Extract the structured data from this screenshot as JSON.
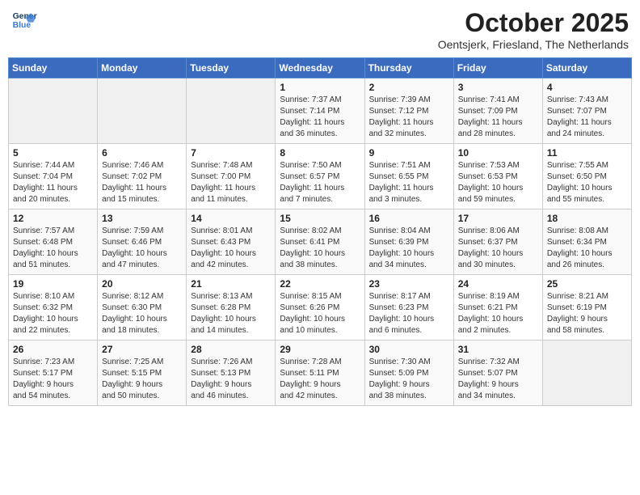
{
  "header": {
    "logo_line1": "General",
    "logo_line2": "Blue",
    "month": "October 2025",
    "location": "Oentsjerk, Friesland, The Netherlands"
  },
  "days_of_week": [
    "Sunday",
    "Monday",
    "Tuesday",
    "Wednesday",
    "Thursday",
    "Friday",
    "Saturday"
  ],
  "weeks": [
    [
      {
        "day": "",
        "info": ""
      },
      {
        "day": "",
        "info": ""
      },
      {
        "day": "",
        "info": ""
      },
      {
        "day": "1",
        "info": "Sunrise: 7:37 AM\nSunset: 7:14 PM\nDaylight: 11 hours\nand 36 minutes."
      },
      {
        "day": "2",
        "info": "Sunrise: 7:39 AM\nSunset: 7:12 PM\nDaylight: 11 hours\nand 32 minutes."
      },
      {
        "day": "3",
        "info": "Sunrise: 7:41 AM\nSunset: 7:09 PM\nDaylight: 11 hours\nand 28 minutes."
      },
      {
        "day": "4",
        "info": "Sunrise: 7:43 AM\nSunset: 7:07 PM\nDaylight: 11 hours\nand 24 minutes."
      }
    ],
    [
      {
        "day": "5",
        "info": "Sunrise: 7:44 AM\nSunset: 7:04 PM\nDaylight: 11 hours\nand 20 minutes."
      },
      {
        "day": "6",
        "info": "Sunrise: 7:46 AM\nSunset: 7:02 PM\nDaylight: 11 hours\nand 15 minutes."
      },
      {
        "day": "7",
        "info": "Sunrise: 7:48 AM\nSunset: 7:00 PM\nDaylight: 11 hours\nand 11 minutes."
      },
      {
        "day": "8",
        "info": "Sunrise: 7:50 AM\nSunset: 6:57 PM\nDaylight: 11 hours\nand 7 minutes."
      },
      {
        "day": "9",
        "info": "Sunrise: 7:51 AM\nSunset: 6:55 PM\nDaylight: 11 hours\nand 3 minutes."
      },
      {
        "day": "10",
        "info": "Sunrise: 7:53 AM\nSunset: 6:53 PM\nDaylight: 10 hours\nand 59 minutes."
      },
      {
        "day": "11",
        "info": "Sunrise: 7:55 AM\nSunset: 6:50 PM\nDaylight: 10 hours\nand 55 minutes."
      }
    ],
    [
      {
        "day": "12",
        "info": "Sunrise: 7:57 AM\nSunset: 6:48 PM\nDaylight: 10 hours\nand 51 minutes."
      },
      {
        "day": "13",
        "info": "Sunrise: 7:59 AM\nSunset: 6:46 PM\nDaylight: 10 hours\nand 47 minutes."
      },
      {
        "day": "14",
        "info": "Sunrise: 8:01 AM\nSunset: 6:43 PM\nDaylight: 10 hours\nand 42 minutes."
      },
      {
        "day": "15",
        "info": "Sunrise: 8:02 AM\nSunset: 6:41 PM\nDaylight: 10 hours\nand 38 minutes."
      },
      {
        "day": "16",
        "info": "Sunrise: 8:04 AM\nSunset: 6:39 PM\nDaylight: 10 hours\nand 34 minutes."
      },
      {
        "day": "17",
        "info": "Sunrise: 8:06 AM\nSunset: 6:37 PM\nDaylight: 10 hours\nand 30 minutes."
      },
      {
        "day": "18",
        "info": "Sunrise: 8:08 AM\nSunset: 6:34 PM\nDaylight: 10 hours\nand 26 minutes."
      }
    ],
    [
      {
        "day": "19",
        "info": "Sunrise: 8:10 AM\nSunset: 6:32 PM\nDaylight: 10 hours\nand 22 minutes."
      },
      {
        "day": "20",
        "info": "Sunrise: 8:12 AM\nSunset: 6:30 PM\nDaylight: 10 hours\nand 18 minutes."
      },
      {
        "day": "21",
        "info": "Sunrise: 8:13 AM\nSunset: 6:28 PM\nDaylight: 10 hours\nand 14 minutes."
      },
      {
        "day": "22",
        "info": "Sunrise: 8:15 AM\nSunset: 6:26 PM\nDaylight: 10 hours\nand 10 minutes."
      },
      {
        "day": "23",
        "info": "Sunrise: 8:17 AM\nSunset: 6:23 PM\nDaylight: 10 hours\nand 6 minutes."
      },
      {
        "day": "24",
        "info": "Sunrise: 8:19 AM\nSunset: 6:21 PM\nDaylight: 10 hours\nand 2 minutes."
      },
      {
        "day": "25",
        "info": "Sunrise: 8:21 AM\nSunset: 6:19 PM\nDaylight: 9 hours\nand 58 minutes."
      }
    ],
    [
      {
        "day": "26",
        "info": "Sunrise: 7:23 AM\nSunset: 5:17 PM\nDaylight: 9 hours\nand 54 minutes."
      },
      {
        "day": "27",
        "info": "Sunrise: 7:25 AM\nSunset: 5:15 PM\nDaylight: 9 hours\nand 50 minutes."
      },
      {
        "day": "28",
        "info": "Sunrise: 7:26 AM\nSunset: 5:13 PM\nDaylight: 9 hours\nand 46 minutes."
      },
      {
        "day": "29",
        "info": "Sunrise: 7:28 AM\nSunset: 5:11 PM\nDaylight: 9 hours\nand 42 minutes."
      },
      {
        "day": "30",
        "info": "Sunrise: 7:30 AM\nSunset: 5:09 PM\nDaylight: 9 hours\nand 38 minutes."
      },
      {
        "day": "31",
        "info": "Sunrise: 7:32 AM\nSunset: 5:07 PM\nDaylight: 9 hours\nand 34 minutes."
      },
      {
        "day": "",
        "info": ""
      }
    ]
  ]
}
